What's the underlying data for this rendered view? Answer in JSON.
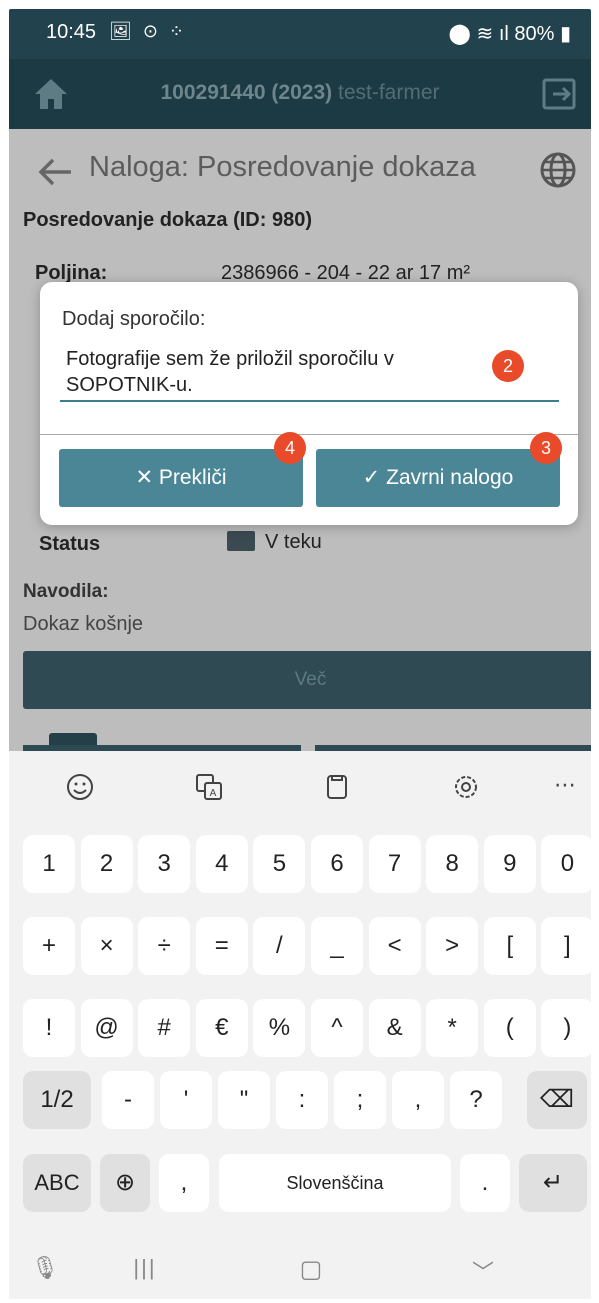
{
  "status_bar": {
    "time": "10:45",
    "left_icons": [
      "image-icon",
      "vpn-icon",
      "grid-icon"
    ],
    "battery": "80%",
    "right_icons": [
      "location-icon",
      "wifi-icon",
      "signal-icon",
      "battery-icon"
    ]
  },
  "app_bar": {
    "id_prefix": "100291440 (2023)",
    "user": "test-farmer",
    "home_icon": "home-icon",
    "exit_icon": "exit-icon"
  },
  "page": {
    "title": "Naloga: Posredovanje dokaza",
    "back_icon": "back-arrow-icon",
    "globe_icon": "globe-icon",
    "section_title": "Posredovanje dokaza (ID: 980)",
    "fields": [
      {
        "label": "Poljina:",
        "value": "2386966 - 204 - 22 ar 17 m²"
      },
      {
        "label": "Status",
        "value": "V teku"
      }
    ],
    "instructions_label": "Navodila:",
    "instructions_text": "Dokaz košnje",
    "more_button": "Več"
  },
  "dialog": {
    "label": "Dodaj sporočilo:",
    "message": "Fotografije sem že priložil sporočilu v SOPOTNIK-u.",
    "cancel_label": "Prekliči",
    "confirm_label": "Zavrni nalogo",
    "badges": [
      "2",
      "3",
      "4"
    ]
  },
  "keyboard": {
    "tools": [
      "emoji-icon",
      "translate-icon",
      "clipboard-icon",
      "settings-icon",
      "more-icon"
    ],
    "row1": [
      "1",
      "2",
      "3",
      "4",
      "5",
      "6",
      "7",
      "8",
      "9",
      "0"
    ],
    "row2": [
      "+",
      "×",
      "÷",
      "=",
      "/",
      "_",
      "<",
      ">",
      "[",
      "]"
    ],
    "row3": [
      "!",
      "@",
      "#",
      "€",
      "%",
      "^",
      "&",
      "*",
      "(",
      ")"
    ],
    "row4": [
      "1/2",
      "-",
      "'",
      "\"",
      ":",
      ";",
      ",",
      "?"
    ],
    "abc": "ABC",
    "comma": ",",
    "space": "Slovenščina",
    "period": ".",
    "nav": [
      "mic-icon",
      "recent-apps-icon",
      "home-circle-icon",
      "back-chevron-icon"
    ]
  }
}
